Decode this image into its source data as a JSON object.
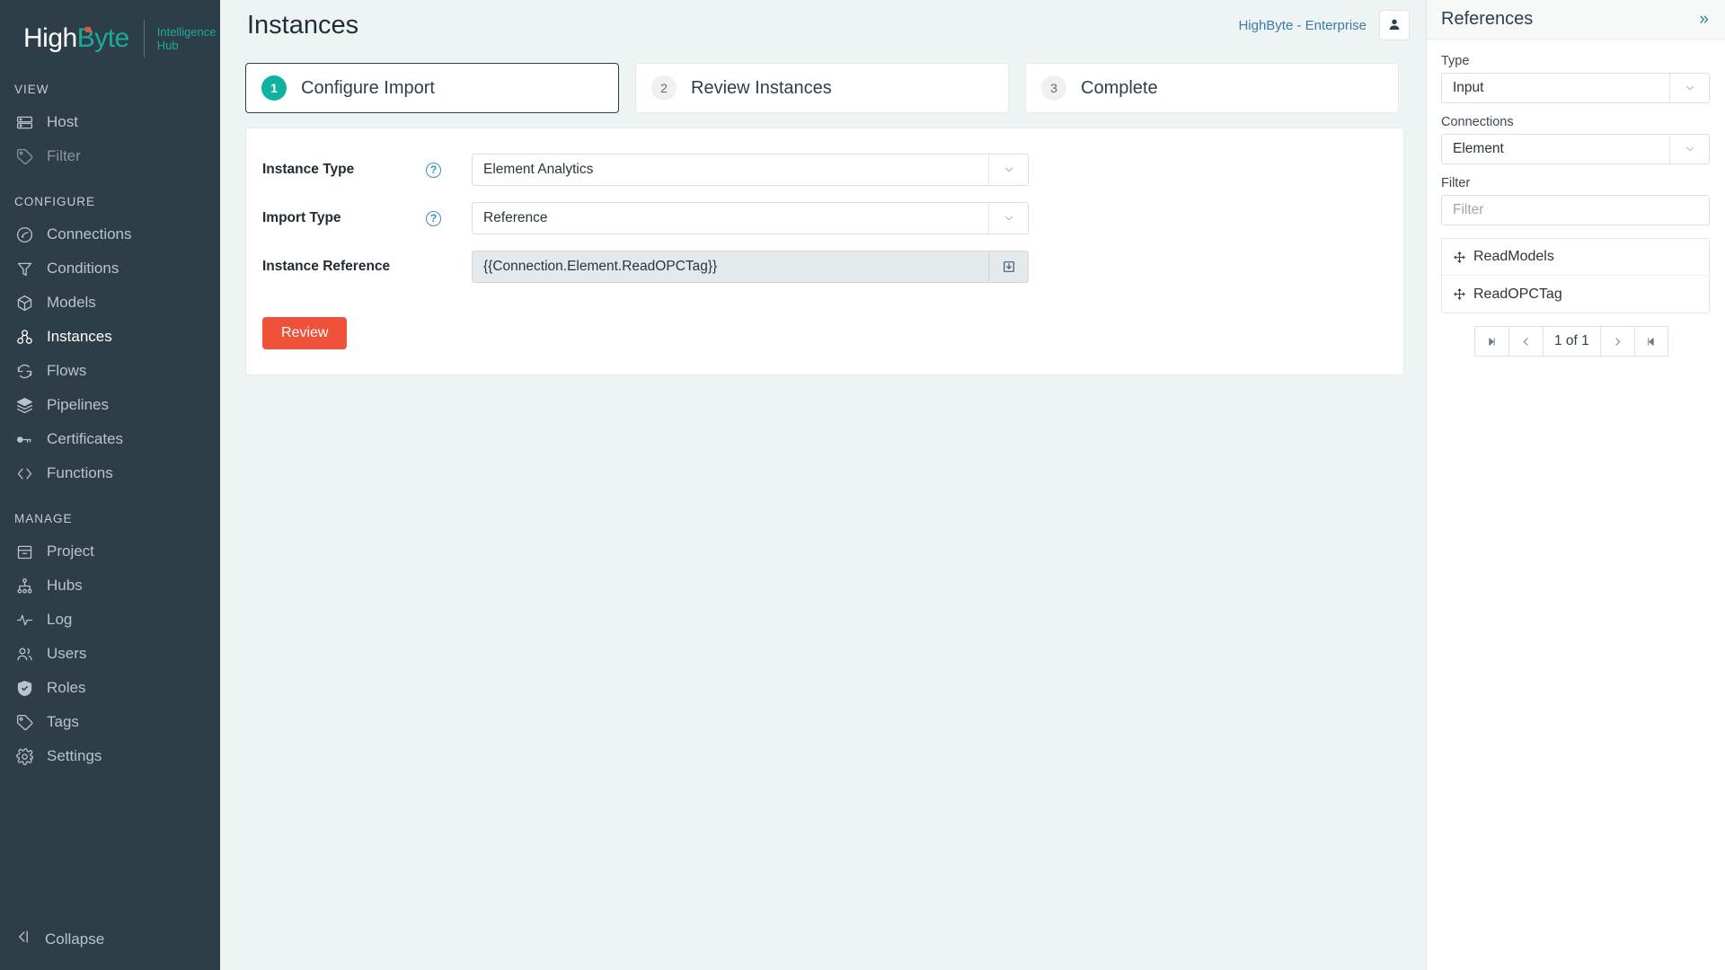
{
  "brand": {
    "name_high": "High",
    "name_byte": "Byte",
    "sub_line1": "Intelligence",
    "sub_line2": "Hub",
    "accent_teal": "#1aab9b",
    "accent_red": "#ef5239",
    "sidebar_bg": "#2d3e48"
  },
  "sidebar": {
    "sections": [
      {
        "title": "VIEW",
        "items": [
          {
            "label": "Host",
            "icon": "server-icon",
            "state": "normal"
          },
          {
            "label": "Filter",
            "icon": "tag-icon",
            "state": "dim"
          }
        ]
      },
      {
        "title": "CONFIGURE",
        "items": [
          {
            "label": "Connections",
            "icon": "plug-icon",
            "state": "normal"
          },
          {
            "label": "Conditions",
            "icon": "funnel-icon",
            "state": "normal"
          },
          {
            "label": "Models",
            "icon": "cube-icon",
            "state": "normal"
          },
          {
            "label": "Instances",
            "icon": "instances-icon",
            "state": "active"
          },
          {
            "label": "Flows",
            "icon": "refresh-icon",
            "state": "normal"
          },
          {
            "label": "Pipelines",
            "icon": "layers-icon",
            "state": "normal"
          },
          {
            "label": "Certificates",
            "icon": "key-icon",
            "state": "normal"
          },
          {
            "label": "Functions",
            "icon": "code-icon",
            "state": "normal"
          }
        ]
      },
      {
        "title": "MANAGE",
        "items": [
          {
            "label": "Project",
            "icon": "archive-icon",
            "state": "normal"
          },
          {
            "label": "Hubs",
            "icon": "hierarchy-icon",
            "state": "normal"
          },
          {
            "label": "Log",
            "icon": "activity-icon",
            "state": "normal"
          },
          {
            "label": "Users",
            "icon": "users-icon",
            "state": "normal"
          },
          {
            "label": "Roles",
            "icon": "shield-check-icon",
            "state": "normal"
          },
          {
            "label": "Tags",
            "icon": "tag-icon",
            "state": "normal"
          },
          {
            "label": "Settings",
            "icon": "gear-icon",
            "state": "normal"
          }
        ]
      }
    ],
    "collapse_label": "Collapse",
    "collapse_icon": "collapse-left-icon"
  },
  "header": {
    "title": "Instances",
    "tenant": "HighByte - Enterprise",
    "avatar_icon": "user-icon"
  },
  "stepper": {
    "steps": [
      {
        "num": "1",
        "label": "Configure Import",
        "active": true
      },
      {
        "num": "2",
        "label": "Review Instances",
        "active": false
      },
      {
        "num": "3",
        "label": "Complete",
        "active": false
      }
    ]
  },
  "form": {
    "instance_type": {
      "label": "Instance Type",
      "help_glyph": "?",
      "value": "Element Analytics",
      "chevron_icon": "chevron-down-icon"
    },
    "import_type": {
      "label": "Import Type",
      "help_glyph": "?",
      "value": "Reference",
      "chevron_icon": "chevron-down-icon"
    },
    "instance_reference": {
      "label": "Instance Reference",
      "value": "{{Connection.Element.ReadOPCTag}}",
      "action_icon": "import-download-icon"
    },
    "review_button": "Review"
  },
  "references": {
    "title": "References",
    "collapse_icon": "chevron-double-right-icon",
    "type": {
      "label": "Type",
      "value": "Input",
      "chevron_icon": "chevron-down-icon"
    },
    "connections": {
      "label": "Connections",
      "value": "Element",
      "chevron_icon": "chevron-down-icon"
    },
    "filter": {
      "label": "Filter",
      "placeholder": "Filter",
      "value": ""
    },
    "items": [
      {
        "label": "ReadModels",
        "icon": "move-arrows-icon"
      },
      {
        "label": "ReadOPCTag",
        "icon": "move-arrows-icon"
      }
    ],
    "pager": {
      "first_icon": "page-first-icon",
      "prev_icon": "page-prev-icon",
      "label": "1 of 1",
      "next_icon": "page-next-icon",
      "last_icon": "page-last-icon"
    }
  }
}
